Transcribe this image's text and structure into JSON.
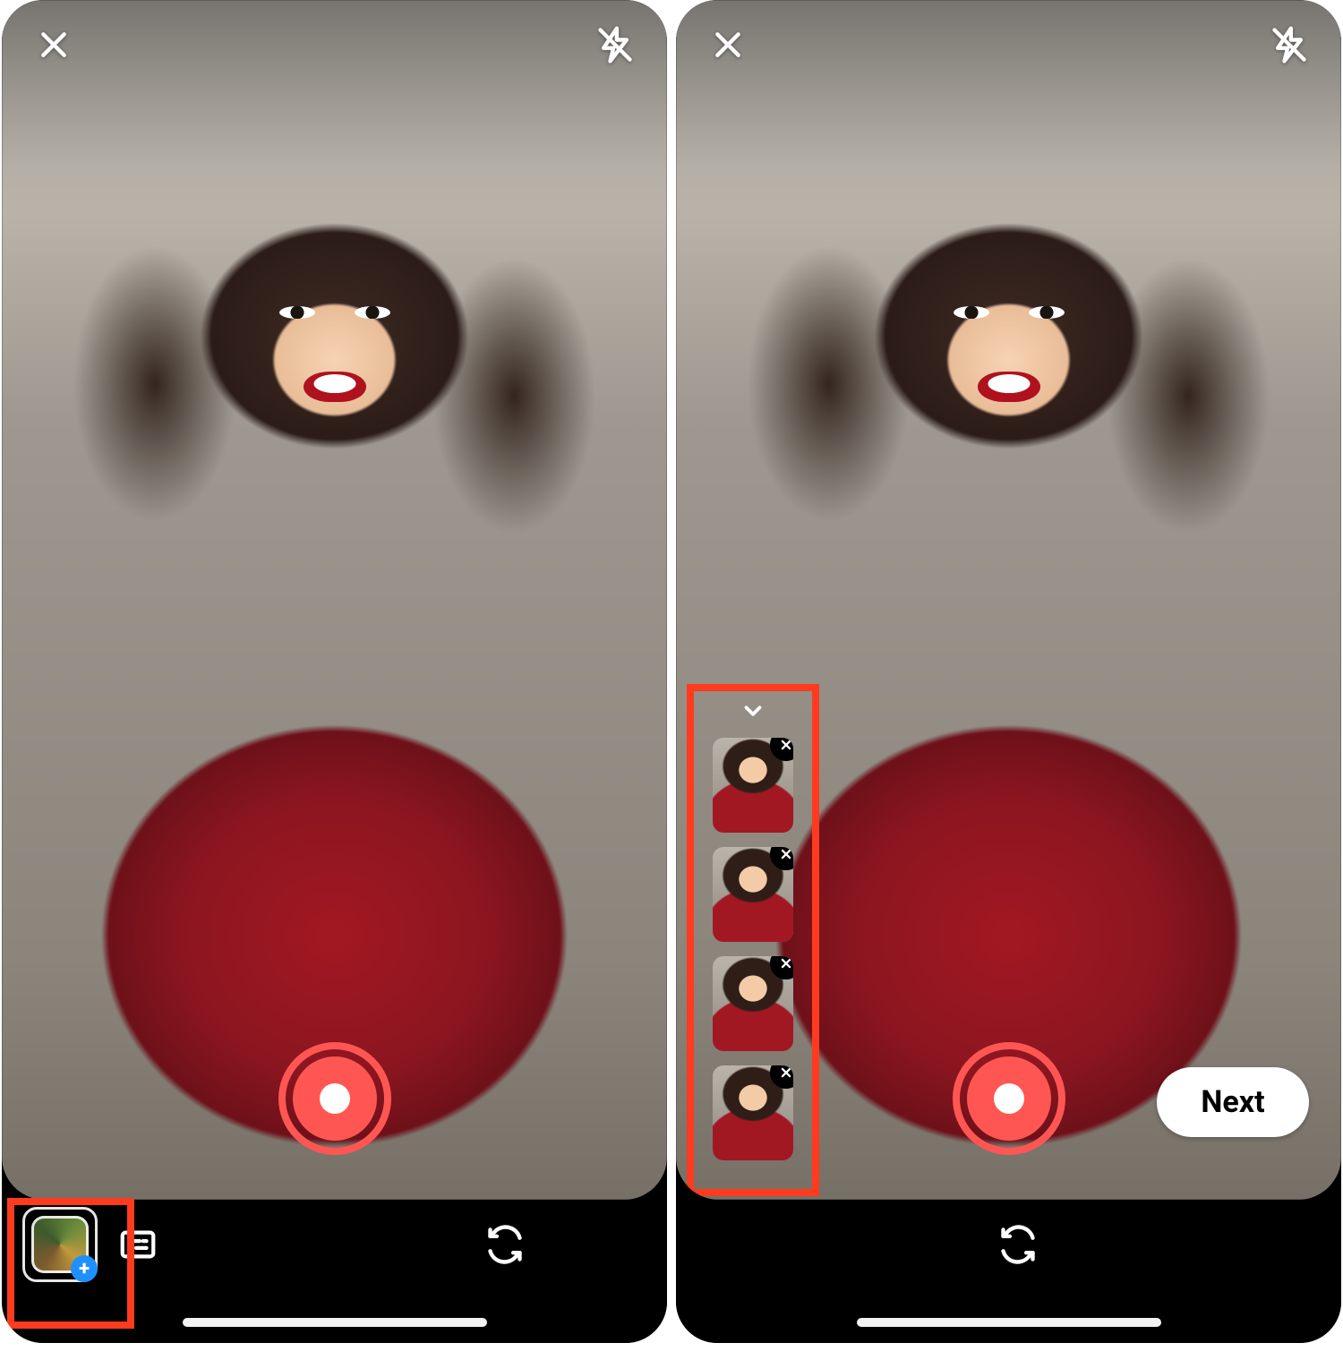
{
  "icons": {
    "close": "close-icon",
    "flash_off": "flash-off-icon",
    "gallery_add": "gallery-add-icon",
    "captions": "captions-icon",
    "switch_camera": "switch-camera-icon",
    "chevron_down": "chevron-down-icon",
    "remove_clip": "remove-clip-icon",
    "plus_badge": "+"
  },
  "colors": {
    "highlight": "#ff3b1f",
    "shutter": "#ff5653",
    "plus_badge": "#1e90ff"
  },
  "left_screen": {
    "state": "camera-ready",
    "has_clips": false,
    "top": {
      "close": true,
      "flash": "off"
    },
    "controls": {
      "shutter": true,
      "next_visible": false
    },
    "bottom": {
      "gallery_button": {
        "visible": true,
        "highlighted": true
      },
      "captions_button": true,
      "switch_camera_button": true
    }
  },
  "right_screen": {
    "state": "clips-captured",
    "top": {
      "close": true,
      "flash": "off"
    },
    "controls": {
      "shutter": true,
      "next_visible": true,
      "next_label": "Next"
    },
    "clip_tray": {
      "highlighted": true,
      "collapse_visible": true,
      "clips": [
        {
          "index": 1,
          "removable": true
        },
        {
          "index": 2,
          "removable": true
        },
        {
          "index": 3,
          "removable": true
        },
        {
          "index": 4,
          "removable": true
        }
      ]
    },
    "bottom": {
      "gallery_button": {
        "visible": false
      },
      "captions_button": false,
      "switch_camera_button": true
    }
  }
}
